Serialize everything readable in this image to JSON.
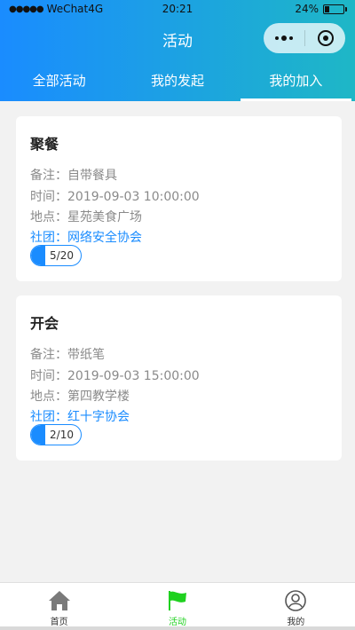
{
  "status_bar": {
    "carrier": "WeChat4G",
    "time": "20:21",
    "battery": "24%",
    "battery_level": 0.24
  },
  "navbar": {
    "title": "活动"
  },
  "tabs": [
    {
      "label": "全部活动",
      "active": false
    },
    {
      "label": "我的发起",
      "active": false
    },
    {
      "label": "我的加入",
      "active": true
    }
  ],
  "activities": [
    {
      "title": "聚餐",
      "note": "备注：自带餐具",
      "time": "时间：2019-09-03 10:00:00",
      "place": "地点：星苑美食广场",
      "club": "社团：网络安全协会",
      "progress_text": "5/20",
      "progress_fraction": 0.25
    },
    {
      "title": "开会",
      "note": "备注：带纸笔",
      "time": "时间：2019-09-03 15:00:00",
      "place": "地点：第四教学楼",
      "club": "社团：红十字协会",
      "progress_text": "2/10",
      "progress_fraction": 0.2
    }
  ],
  "tabbar": [
    {
      "label": "首页",
      "icon": "home-icon",
      "active": false
    },
    {
      "label": "活动",
      "icon": "flag-icon",
      "active": true
    },
    {
      "label": "我的",
      "icon": "user-icon",
      "active": false
    }
  ],
  "colors": {
    "accent": "#1a8cff",
    "tabbar_active": "#1fd11f"
  }
}
